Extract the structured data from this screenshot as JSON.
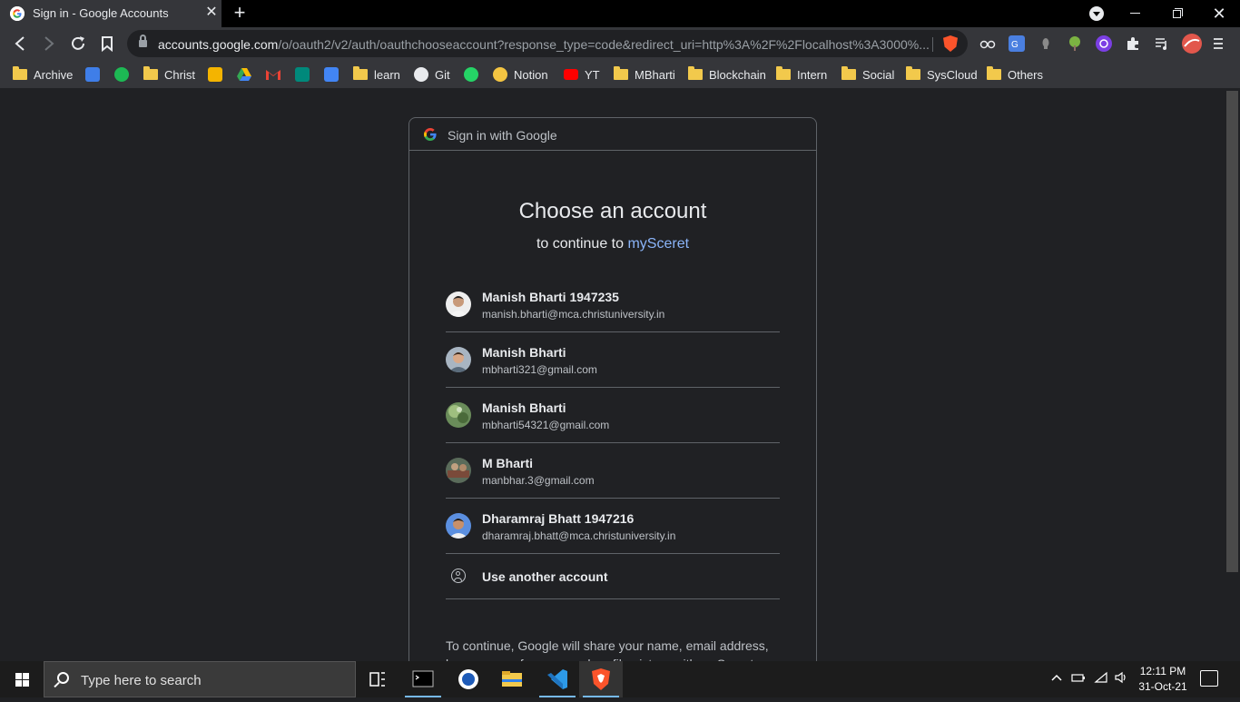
{
  "tab": {
    "title": "Sign in - Google Accounts",
    "close_glyph": "✕"
  },
  "new_tab_glyph": "+",
  "window": {
    "close_glyph": "✕"
  },
  "address_bar": {
    "host": "accounts.google.com",
    "path": "/o/oauth2/v2/auth/oauthchooseaccount?response_type=code&redirect_uri=http%3A%2F%2Flocalhost%3A3000%..."
  },
  "bookmarks": [
    {
      "label": "Archive",
      "icon": "folder-icon"
    },
    {
      "label": "",
      "icon": "google-sheets-icon"
    },
    {
      "label": "",
      "icon": "spotify-icon"
    },
    {
      "label": "Christ",
      "icon": "folder-icon"
    },
    {
      "label": "",
      "icon": "google-classroom-icon"
    },
    {
      "label": "",
      "icon": "google-drive-icon"
    },
    {
      "label": "",
      "icon": "gmail-icon"
    },
    {
      "label": "",
      "icon": "google-meet-icon"
    },
    {
      "label": "",
      "icon": "google-calendar-icon"
    },
    {
      "label": "learn",
      "icon": "folder-icon"
    },
    {
      "label": "Git",
      "icon": "github-icon"
    },
    {
      "label": "",
      "icon": "whatsapp-icon"
    },
    {
      "label": "Notion",
      "icon": "notion-icon"
    },
    {
      "label": "YT",
      "icon": "youtube-icon"
    },
    {
      "label": "MBharti",
      "icon": "folder-icon"
    },
    {
      "label": "Blockchain",
      "icon": "folder-icon"
    },
    {
      "label": "Intern",
      "icon": "folder-icon"
    },
    {
      "label": "Social",
      "icon": "folder-icon"
    },
    {
      "label": "SysCloud",
      "icon": "folder-icon"
    },
    {
      "label": "Others",
      "icon": "folder-icon"
    }
  ],
  "signin": {
    "header": "Sign in with Google",
    "title": "Choose an account",
    "continue_prefix": "to continue to",
    "app_name": "mySceret",
    "accounts": [
      {
        "name": "Manish Bharti 1947235",
        "email": "manish.bharti@mca.christuniversity.in"
      },
      {
        "name": "Manish Bharti",
        "email": "mbharti321@gmail.com"
      },
      {
        "name": "Manish Bharti",
        "email": "mbharti54321@gmail.com"
      },
      {
        "name": "M Bharti",
        "email": "manbhar.3@gmail.com"
      },
      {
        "name": "Dharamraj Bhatt 1947216",
        "email": "dharamraj.bhatt@mca.christuniversity.in"
      }
    ],
    "use_another": "Use another account",
    "share_text": "To continue, Google will share your name, email address, language preference, and profile picture with mySceret."
  },
  "taskbar": {
    "search_placeholder": "Type here to search",
    "time": "12:11 PM",
    "date": "31-Oct-21"
  },
  "colors": {
    "link": "#8ab4f8",
    "page_bg": "#202124",
    "chrome": "#35363a"
  }
}
